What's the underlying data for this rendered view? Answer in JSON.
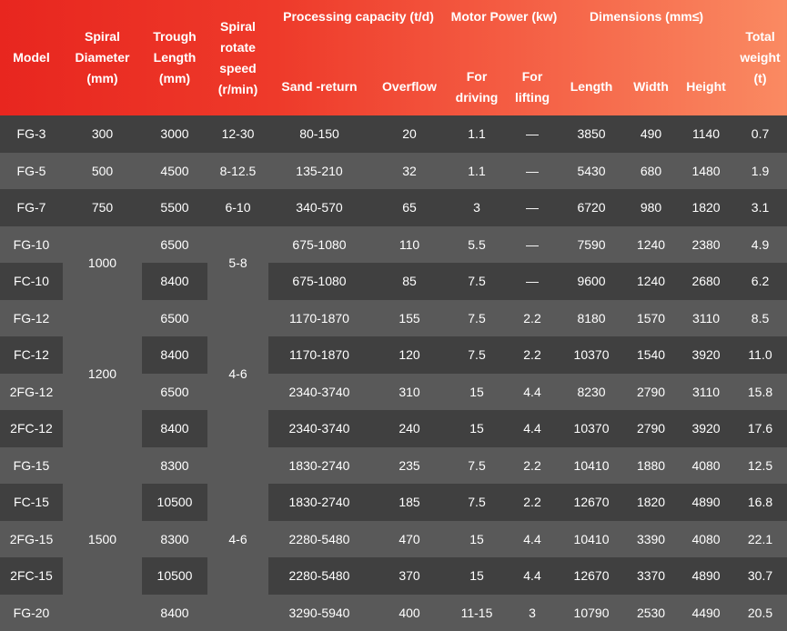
{
  "header": {
    "model": "Model",
    "spiral_diameter": "Spiral Diameter (mm)",
    "trough_length": "Trough Length (mm)",
    "spiral_speed": "Spiral rotate speed (r/min)",
    "processing": "Processing capacity  (t/d)",
    "motor_power": "Motor Power (kw)",
    "dimensions": "Dimensions (mm≤)",
    "total_weight": "Total weight (t)",
    "sand_return": "Sand -return",
    "overflow": "Overflow",
    "for_driving": "For driving",
    "for_lifting": "For lifting",
    "length": "Length",
    "width": "Width",
    "height": "Height"
  },
  "merged": {
    "diam_1000": "1000",
    "diam_1200": "1200",
    "diam_1500": "1500",
    "speed_5_8": "5-8",
    "speed_4_6_a": "4-6",
    "speed_4_6_b": "4-6"
  },
  "rows": [
    {
      "model": "FG-3",
      "diameter": "300",
      "length": "3000",
      "speed": "12-30",
      "sand": "80-150",
      "overflow": "20",
      "driving": "1.1",
      "lifting": "—",
      "dim_l": "3850",
      "dim_w": "490",
      "dim_h": "1140",
      "weight": "0.7"
    },
    {
      "model": "FG-5",
      "diameter": "500",
      "length": "4500",
      "speed": "8-12.5",
      "sand": "135-210",
      "overflow": "32",
      "driving": "1.1",
      "lifting": "—",
      "dim_l": "5430",
      "dim_w": "680",
      "dim_h": "1480",
      "weight": "1.9"
    },
    {
      "model": "FG-7",
      "diameter": "750",
      "length": "5500",
      "speed": "6-10",
      "sand": "340-570",
      "overflow": "65",
      "driving": "3",
      "lifting": "—",
      "dim_l": "6720",
      "dim_w": "980",
      "dim_h": "1820",
      "weight": "3.1"
    },
    {
      "model": "FG-10",
      "length": "6500",
      "sand": "675-1080",
      "overflow": "110",
      "driving": "5.5",
      "lifting": "—",
      "dim_l": "7590",
      "dim_w": "1240",
      "dim_h": "2380",
      "weight": "4.9"
    },
    {
      "model": "FC-10",
      "length": "8400",
      "sand": "675-1080",
      "overflow": "85",
      "driving": "7.5",
      "lifting": "—",
      "dim_l": "9600",
      "dim_w": "1240",
      "dim_h": "2680",
      "weight": "6.2"
    },
    {
      "model": "FG-12",
      "length": "6500",
      "sand": "1170-1870",
      "overflow": "155",
      "driving": "7.5",
      "lifting": "2.2",
      "dim_l": "8180",
      "dim_w": "1570",
      "dim_h": "3110",
      "weight": "8.5"
    },
    {
      "model": "FC-12",
      "length": "8400",
      "sand": "1170-1870",
      "overflow": "120",
      "driving": "7.5",
      "lifting": "2.2",
      "dim_l": "10370",
      "dim_w": "1540",
      "dim_h": "3920",
      "weight": "11.0"
    },
    {
      "model": "2FG-12",
      "length": "6500",
      "sand": "2340-3740",
      "overflow": "310",
      "driving": "15",
      "lifting": "4.4",
      "dim_l": "8230",
      "dim_w": "2790",
      "dim_h": "3110",
      "weight": "15.8"
    },
    {
      "model": "2FC-12",
      "length": "8400",
      "sand": "2340-3740",
      "overflow": "240",
      "driving": "15",
      "lifting": "4.4",
      "dim_l": "10370",
      "dim_w": "2790",
      "dim_h": "3920",
      "weight": "17.6"
    },
    {
      "model": "FG-15",
      "length": "8300",
      "sand": "1830-2740",
      "overflow": "235",
      "driving": "7.5",
      "lifting": "2.2",
      "dim_l": "10410",
      "dim_w": "1880",
      "dim_h": "4080",
      "weight": "12.5"
    },
    {
      "model": "FC-15",
      "length": "10500",
      "sand": "1830-2740",
      "overflow": "185",
      "driving": "7.5",
      "lifting": "2.2",
      "dim_l": "12670",
      "dim_w": "1820",
      "dim_h": "4890",
      "weight": "16.8"
    },
    {
      "model": "2FG-15",
      "length": "8300",
      "sand": "2280-5480",
      "overflow": "470",
      "driving": "15",
      "lifting": "4.4",
      "dim_l": "10410",
      "dim_w": "3390",
      "dim_h": "4080",
      "weight": "22.1"
    },
    {
      "model": "2FC-15",
      "length": "10500",
      "sand": "2280-5480",
      "overflow": "370",
      "driving": "15",
      "lifting": "4.4",
      "dim_l": "12670",
      "dim_w": "3370",
      "dim_h": "4890",
      "weight": "30.7"
    },
    {
      "model": "FG-20",
      "length": "8400",
      "sand": "3290-5940",
      "overflow": "400",
      "driving": "11-15",
      "lifting": "3",
      "dim_l": "10790",
      "dim_w": "2530",
      "dim_h": "4490",
      "weight": "20.5"
    }
  ]
}
